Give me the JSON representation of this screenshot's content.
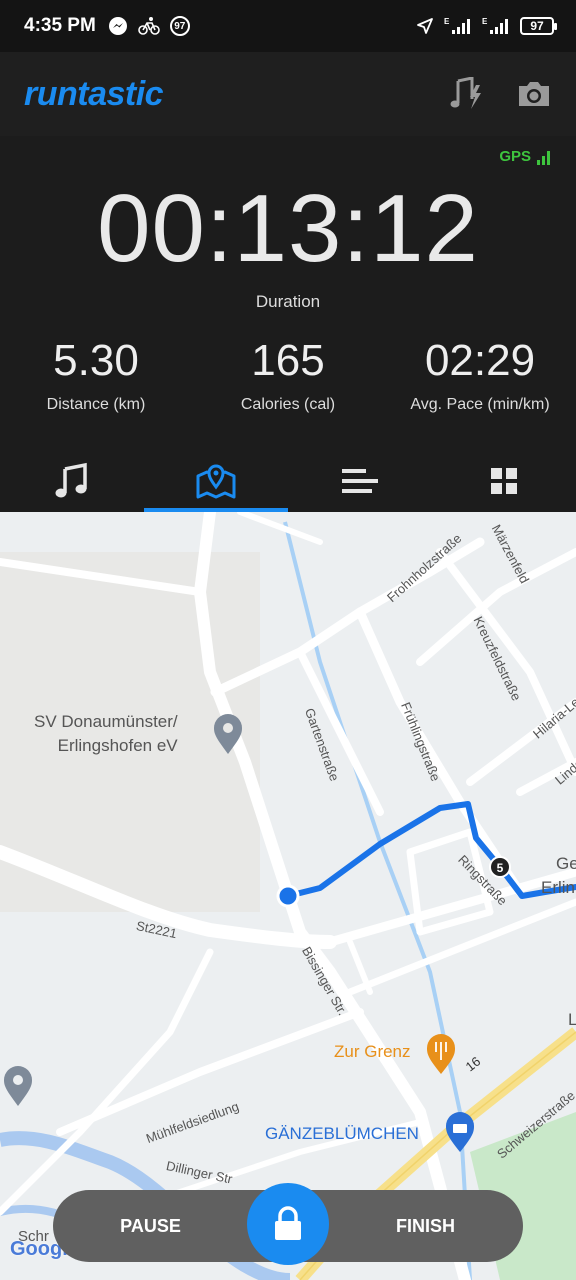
{
  "status_bar": {
    "time": "4:35 PM",
    "notification_badge": "97",
    "battery": "97",
    "net_1": "E",
    "net_2": "E"
  },
  "app": {
    "logo": "runtastic"
  },
  "gps": {
    "label": "GPS",
    "color": "#3ec43e"
  },
  "session": {
    "duration": "00:13:12",
    "duration_label": "Duration",
    "distance": "5.30",
    "distance_label": "Distance (km)",
    "calories": "165",
    "calories_label": "Calories (cal)",
    "pace": "02:29",
    "pace_label": "Avg. Pace (min/km)"
  },
  "tabs": [
    {
      "icon": "music-note-icon",
      "active": false
    },
    {
      "icon": "map-pin-icon",
      "active": true
    },
    {
      "icon": "bar-list-icon",
      "active": false
    },
    {
      "icon": "grid-icon",
      "active": false
    }
  ],
  "map": {
    "streets": {
      "frohnholz": "Frohnholzstraße",
      "maerzenfeld": "Märzenfeld",
      "kreuzfeld": "Kreuzfeldstraße",
      "hilaria": "Hilaria-Le",
      "linde": "Linde",
      "garten": "Gartenstraße",
      "fruehling": "Frühlingstraße",
      "ring": "Ringstraße",
      "st2221": "St2221",
      "bissinger": "Bissinger Str.",
      "muehlfeld": "Mühlfeldsiedlung",
      "dillinger": "Dillinger Str",
      "schweizer": "Schweizerstraße",
      "route16": "16"
    },
    "pois": {
      "sv": "SV Donaumünster/\nErlingshofen eV",
      "zur_grenz": "Zur Grenz",
      "gaenze": "GÄNZEBLÜMCHEN",
      "ge": "Ge",
      "erlin": "Erlin",
      "l": "L",
      "schr": "Schr"
    },
    "km_marker": "5",
    "attribution": "Google"
  },
  "controls": {
    "pause": "PAUSE",
    "finish": "FINISH"
  },
  "colors": {
    "accent": "#1a8bf0",
    "route": "#1a73e8",
    "food_poi": "#e8901a",
    "shop_poi": "#2a6fd6"
  }
}
